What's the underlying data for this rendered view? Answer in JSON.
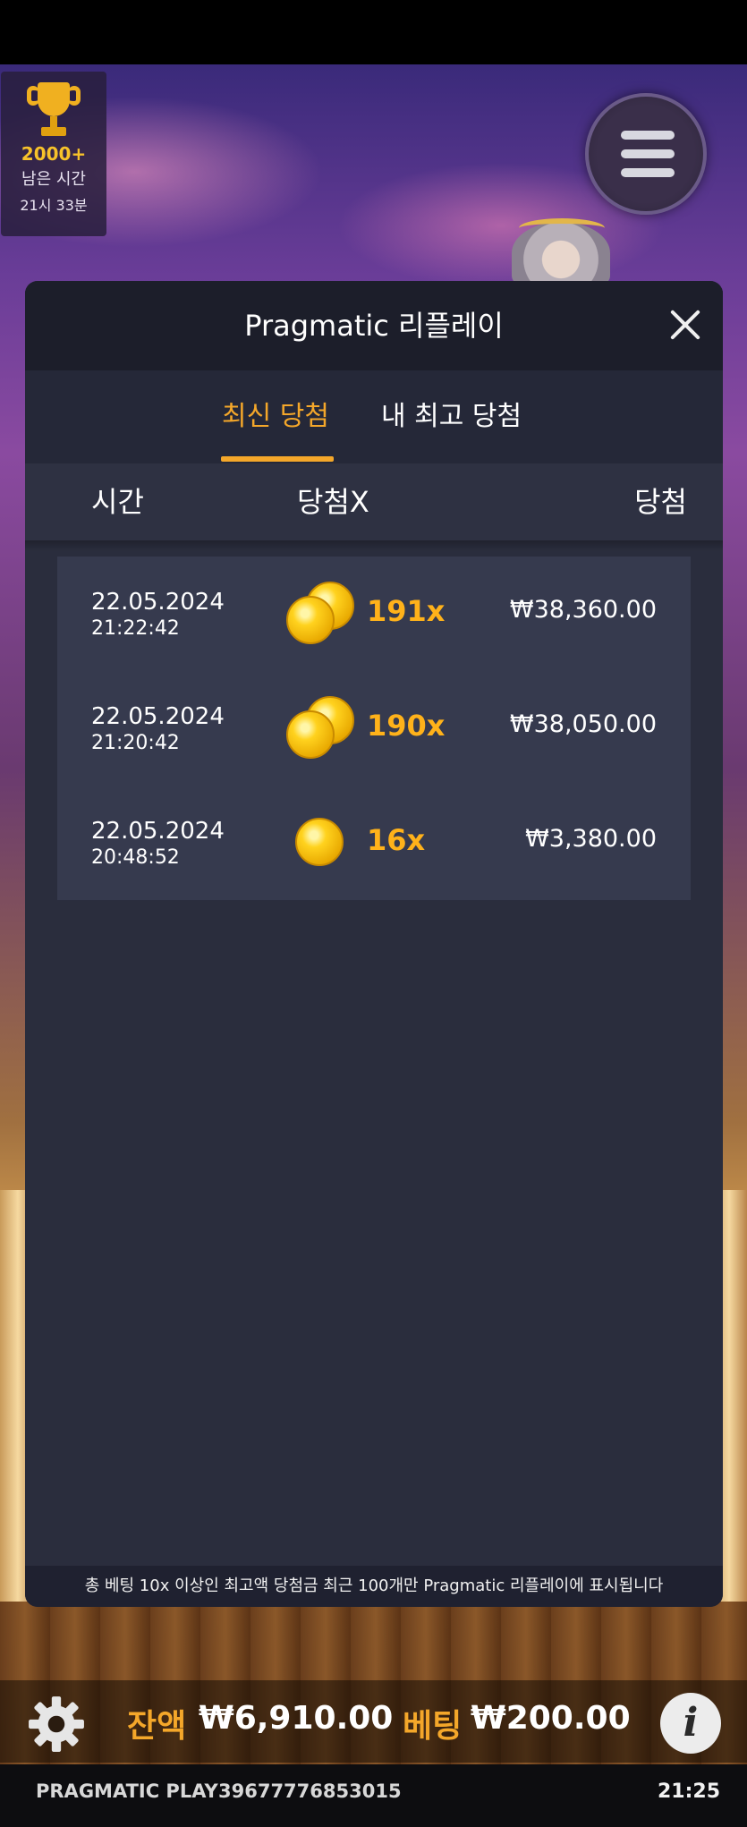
{
  "trophy": {
    "count": "2000+",
    "label": "남은 시간",
    "time_left": "21시 33분"
  },
  "modal": {
    "title": "Pragmatic 리플레이",
    "tabs": [
      {
        "label": "최신 당첨",
        "active": true
      },
      {
        "label": "내 최고 당첨",
        "active": false
      }
    ],
    "columns": {
      "time": "시간",
      "multiplier": "당첨X",
      "win": "당첨"
    },
    "rows": [
      {
        "date": "22.05.2024",
        "time": "21:22:42",
        "multiplier": "191x",
        "amount": "₩38,360.00",
        "coins": 2
      },
      {
        "date": "22.05.2024",
        "time": "21:20:42",
        "multiplier": "190x",
        "amount": "₩38,050.00",
        "coins": 2
      },
      {
        "date": "22.05.2024",
        "time": "20:48:52",
        "multiplier": "16x",
        "amount": "₩3,380.00",
        "coins": 1
      }
    ],
    "footer_note": "총 베팅 10x 이상인 최고액 당첨금 최근 100개만 Pragmatic 리플레이에 표시됩니다"
  },
  "bottom_bar": {
    "balance_label": "잔액",
    "balance_value": "₩6,910.00",
    "bet_label": "베팅",
    "bet_value": "₩200.00",
    "info_symbol": "i"
  },
  "status": {
    "brand": "PRAGMATIC PLAY",
    "session_id": "39677776853015",
    "clock": "21:25"
  },
  "colors": {
    "accent": "#f4a72a",
    "multiplier": "#ffb21a",
    "modal_bg": "#2a2d3d",
    "row_bg": "#363a4e"
  }
}
